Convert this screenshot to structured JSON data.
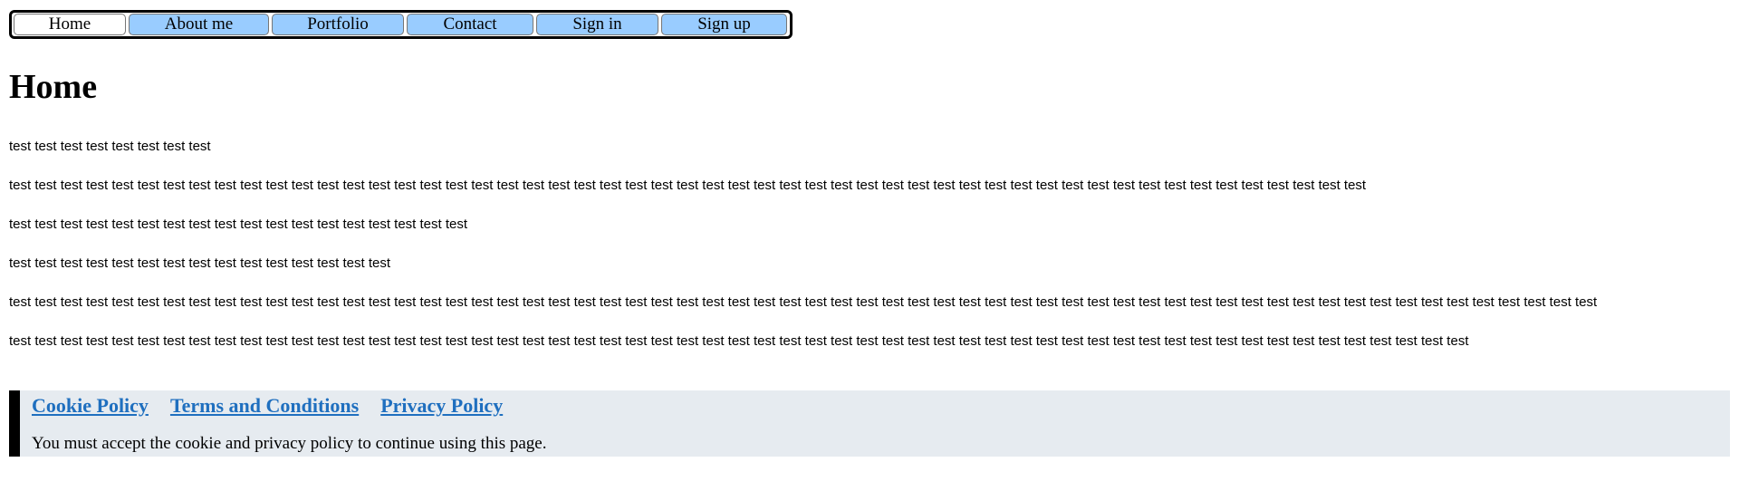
{
  "nav": {
    "items": [
      {
        "label": "Home"
      },
      {
        "label": "About me"
      },
      {
        "label": "Portfolio"
      },
      {
        "label": "Contact"
      },
      {
        "label": "Sign in"
      },
      {
        "label": "Sign up"
      }
    ],
    "active_index": 0
  },
  "page": {
    "title": "Home",
    "paragraphs": [
      "test test test test test test test test",
      "test test test test test test test test test test test test test test test test test test test test test test test test test test test test test test test test test test test test test test test test test test test test test test test test test test test test test",
      "test test test test test test test test test test test test test test test test test test",
      "test test test test test test test test test test test test test test test",
      "test test test test test test test test test test test test test test test test test test test test test test test test test test test test test test test test test test test test test test test test test test test test test test test test test test test test test test test test test test test test test test",
      "test test test test test test test test test test test test test test test test test test test test test test test test test test test test test test test test test test test test test test test test test test test test test test test test test test test test test test test test test"
    ]
  },
  "cookie_banner": {
    "links": [
      {
        "label": "Cookie Policy"
      },
      {
        "label": "Terms and Conditions"
      },
      {
        "label": "Privacy Policy"
      }
    ],
    "message": "You must accept the cookie and privacy policy to continue using this page."
  },
  "colors": {
    "nav_button": "#99ccff",
    "nav_active": "#ffffff",
    "banner_bg": "#e6ebf0",
    "link": "#1f6fbf"
  }
}
